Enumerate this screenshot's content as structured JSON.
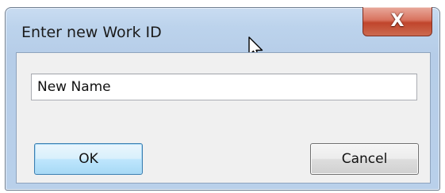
{
  "window": {
    "title": "Enter new Work ID",
    "close_icon": "close-icon",
    "close_glyph": "X"
  },
  "form": {
    "work_id_value": "New Name"
  },
  "buttons": {
    "ok_label": "OK",
    "cancel_label": "Cancel"
  },
  "colors": {
    "close_button": "#c74a32",
    "ok_border": "#3c7fb1",
    "frame": "#b9d0ea"
  }
}
